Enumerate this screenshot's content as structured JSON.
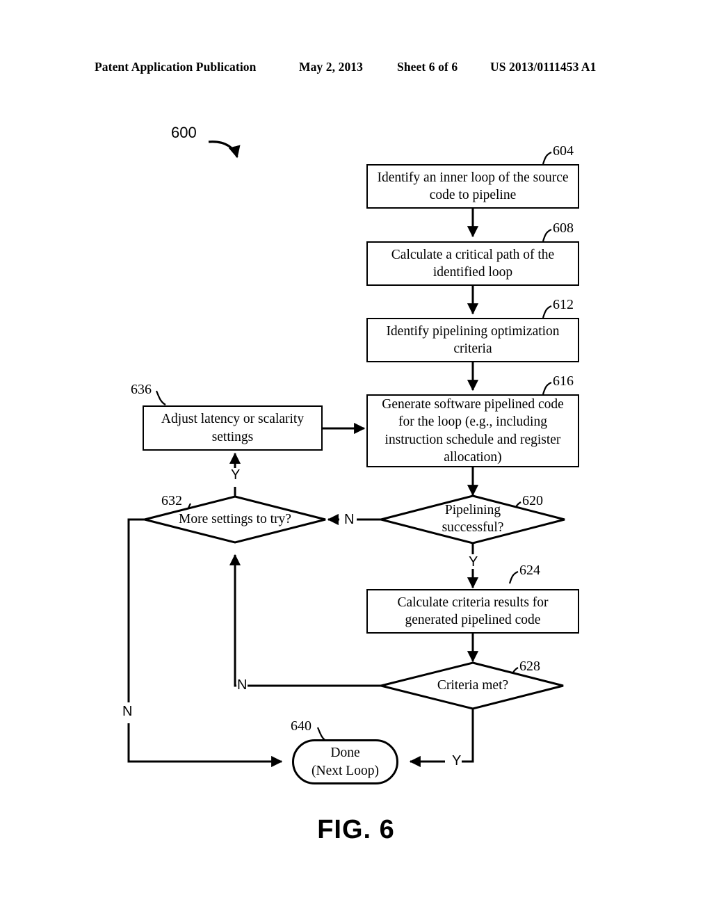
{
  "header": {
    "publication": "Patent Application Publication",
    "date": "May 2, 2013",
    "sheet": "Sheet 6 of 6",
    "number": "US 2013/0111453 A1"
  },
  "figure": {
    "caption": "FIG. 6",
    "diagram_ref": "600"
  },
  "nodes": [
    {
      "id": "604",
      "ref": "604",
      "shape": "process",
      "text": "Identify an inner loop of the source code to pipeline"
    },
    {
      "id": "608",
      "ref": "608",
      "shape": "process",
      "text": "Calculate a critical path of the identified loop"
    },
    {
      "id": "612",
      "ref": "612",
      "shape": "process",
      "text": "Identify pipelining optimization criteria"
    },
    {
      "id": "616",
      "ref": "616",
      "shape": "process",
      "text": "Generate software pipelined code for the loop (e.g., including instruction schedule and register allocation)"
    },
    {
      "id": "620",
      "ref": "620",
      "shape": "decision",
      "text": "Pipelining successful?"
    },
    {
      "id": "624",
      "ref": "624",
      "shape": "process",
      "text": "Calculate criteria results for generated pipelined code"
    },
    {
      "id": "628",
      "ref": "628",
      "shape": "decision",
      "text": "Criteria met?"
    },
    {
      "id": "632",
      "ref": "632",
      "shape": "decision",
      "text": "More settings to try?"
    },
    {
      "id": "636",
      "ref": "636",
      "shape": "process",
      "text": "Adjust latency or scalarity settings"
    },
    {
      "id": "640",
      "ref": "640",
      "shape": "terminal",
      "text": "Done\n(Next Loop)"
    }
  ],
  "node_text": {
    "n604_line1": "Identify an inner loop of the source",
    "n604_line2": "code to pipeline",
    "n608_line1": "Calculate a critical path of the",
    "n608_line2": "identified loop",
    "n612_line1": "Identify pipelining optimization",
    "n612_line2": "criteria",
    "n616_line1": "Generate software pipelined code",
    "n616_line2": "for the loop (e.g., including",
    "n616_line3": "instruction schedule and register",
    "n616_line4": "allocation)",
    "n620_line1": "Pipelining",
    "n620_line2": "successful?",
    "n624_line1": "Calculate criteria results for",
    "n624_line2": "generated pipelined code",
    "n628_line1": "Criteria met?",
    "n632_line1": "More settings to try?",
    "n636_line1": "Adjust latency or scalarity",
    "n636_line2": "settings",
    "n640_line1": "Done",
    "n640_line2": "(Next Loop)"
  },
  "refs": {
    "r604": "604",
    "r608": "608",
    "r612": "612",
    "r616": "616",
    "r620": "620",
    "r624": "624",
    "r628": "628",
    "r632": "632",
    "r636": "636",
    "r640": "640"
  },
  "branches": {
    "b620_no": "N",
    "b620_yes": "Y",
    "b628_no": "N",
    "b628_yes": "Y",
    "b632_yes": "Y",
    "b632_no": "N"
  },
  "colors": {
    "ink": "#000000",
    "paper": "#ffffff"
  }
}
